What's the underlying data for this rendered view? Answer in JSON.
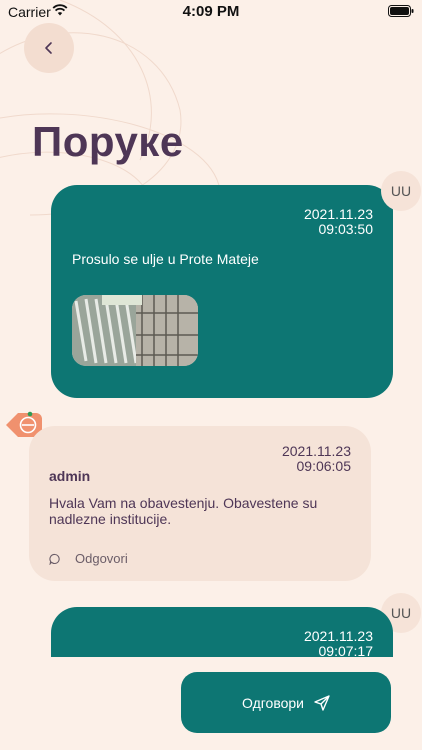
{
  "status": {
    "carrier": "Carrier",
    "time": "4:09 PM"
  },
  "header": {
    "title": "Поруке"
  },
  "messages": [
    {
      "type": "user",
      "avatar": "UU",
      "date": "2021.11.23",
      "time": "09:03:50",
      "text": "Prosulo se ulje u Prote Mateje",
      "has_photo": true
    },
    {
      "type": "admin",
      "author": "admin",
      "date": "2021.11.23",
      "time": "09:06:05",
      "text": "Hvala Vam na obavestenju. Obavestene su nadlezne institucije.",
      "reply_label": "Odgovori"
    },
    {
      "type": "user",
      "avatar": "UU",
      "date": "2021.11.23",
      "time": "09:07:17"
    }
  ],
  "footer": {
    "reply_button_label": "Одговори"
  },
  "colors": {
    "background": "#fcf0e8",
    "primary": "#0d7673",
    "title": "#4e3656",
    "admin_bubble": "#f5e3d8",
    "badge": "#f0916e"
  },
  "icons": {
    "back": "chevron-left-icon",
    "send": "paper-plane-icon",
    "comment": "comment-icon",
    "badge": "city-logo-icon"
  }
}
